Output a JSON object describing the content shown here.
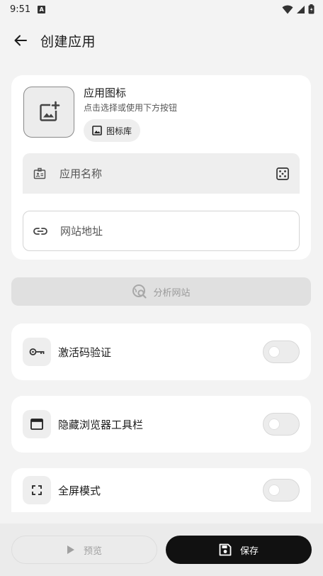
{
  "status": {
    "time": "9:51"
  },
  "header": {
    "title": "创建应用"
  },
  "icon_section": {
    "title": "应用图标",
    "subtitle": "点击选择或使用下方按钮",
    "gallery_label": "图标库"
  },
  "fields": {
    "name_placeholder": "应用名称",
    "url_placeholder": "网站地址"
  },
  "analyze": {
    "label": "分析网站",
    "enabled": false
  },
  "toggles": [
    {
      "label": "激活码验证",
      "on": false
    },
    {
      "label": "隐藏浏览器工具栏",
      "on": false
    },
    {
      "label": "全屏模式",
      "on": false
    }
  ],
  "footer": {
    "preview_label": "预览",
    "save_label": "保存"
  }
}
